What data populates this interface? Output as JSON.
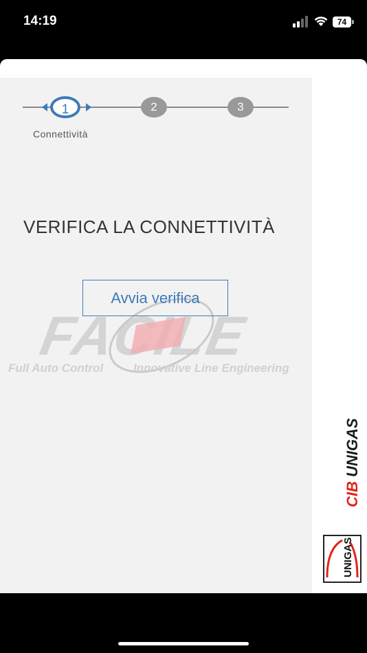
{
  "status_bar": {
    "time": "14:19",
    "battery": "74"
  },
  "stepper": {
    "steps": [
      {
        "number": "1",
        "label": "Connettività",
        "active": true
      },
      {
        "number": "2",
        "active": false
      },
      {
        "number": "3",
        "active": false
      }
    ],
    "active_color": "#3d7ab8",
    "inactive_color": "#999999"
  },
  "main": {
    "title": "VERIFICA LA CONNETTIVITÀ",
    "verify_button_label": "Avvia verifica"
  },
  "watermark": {
    "word": "FACILE",
    "caption_left": "Full Auto Control",
    "caption_right": "Innovative Line Engineering"
  },
  "brand": {
    "cib": "CIB",
    "unigas": "UNIGAS",
    "badge": "UNIGAS"
  }
}
